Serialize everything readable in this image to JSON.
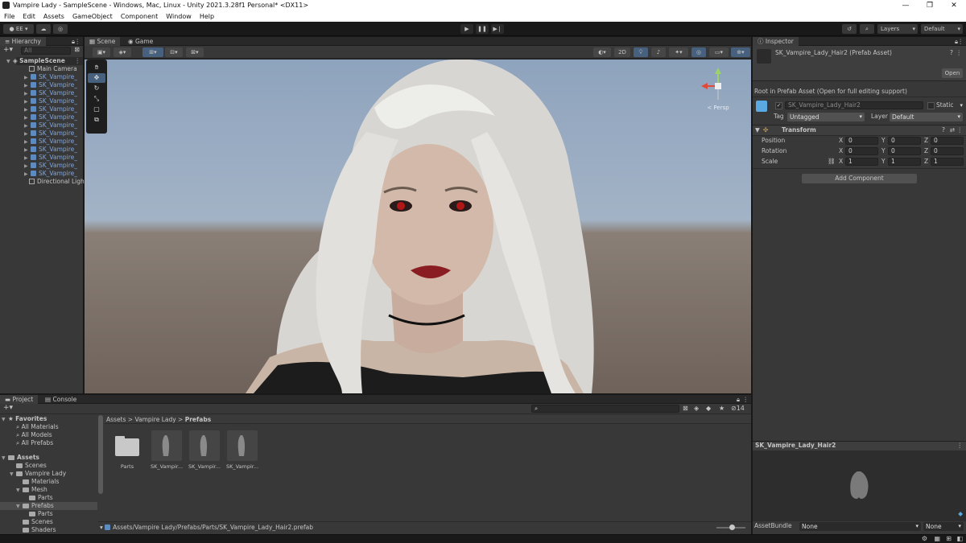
{
  "window": {
    "title": "Vampire Lady - SampleScene - Windows, Mac, Linux - Unity 2021.3.28f1 Personal* <DX11>"
  },
  "menu": [
    "File",
    "Edit",
    "Assets",
    "GameObject",
    "Component",
    "Window",
    "Help"
  ],
  "toolbar": {
    "account_label": "EE",
    "layers_label": "Layers",
    "layout_label": "Default"
  },
  "hierarchy": {
    "tab": "Hierarchy",
    "search_placeholder": "All",
    "scene": "SampleScene",
    "items": [
      "Main Camera",
      "SK_Vampire_",
      "SK_Vampire_",
      "SK_Vampire_",
      "SK_Vampire_",
      "SK_Vampire_",
      "SK_Vampire_",
      "SK_Vampire_",
      "SK_Vampire_",
      "SK_Vampire_",
      "SK_Vampire_",
      "SK_Vampire_",
      "SK_Vampire_",
      "SK_Vampire_",
      "Directional Ligh"
    ]
  },
  "scene": {
    "tabs": [
      "Scene",
      "Game"
    ],
    "mode_2d": "2D",
    "gizmo_label": "< Persp"
  },
  "inspector": {
    "tab": "Inspector",
    "asset_name": "SK_Vampire_Lady_Hair2 (Prefab Asset)",
    "open_label": "Open",
    "root_note": "Root in Prefab Asset (Open for full editing support)",
    "object_name": "SK_Vampire_Lady_Hair2",
    "static_label": "Static",
    "tag_label": "Tag",
    "tag_value": "Untagged",
    "layer_label": "Layer",
    "layer_value": "Default",
    "transform": {
      "title": "Transform",
      "rows": [
        {
          "label": "Position",
          "x": "0",
          "y": "0",
          "z": "0"
        },
        {
          "label": "Rotation",
          "x": "0",
          "y": "0",
          "z": "0"
        },
        {
          "label": "Scale",
          "x": "1",
          "y": "1",
          "z": "1"
        }
      ],
      "axis_x": "X",
      "axis_y": "Y",
      "axis_z": "Z"
    },
    "add_component": "Add Component",
    "preview_title": "SK_Vampire_Lady_Hair2",
    "assetbundle_label": "AssetBundle",
    "assetbundle_value": "None",
    "variant_value": "None"
  },
  "project": {
    "tabs": [
      "Project",
      "Console"
    ],
    "favorites_label": "Favorites",
    "favorites": [
      "All Materials",
      "All Models",
      "All Prefabs"
    ],
    "assets_label": "Assets",
    "tree": [
      {
        "label": "Scenes",
        "indent": 1
      },
      {
        "label": "Vampire Lady",
        "indent": 1
      },
      {
        "label": "Materials",
        "indent": 2
      },
      {
        "label": "Mesh",
        "indent": 2
      },
      {
        "label": "Parts",
        "indent": 3
      },
      {
        "label": "Prefabs",
        "indent": 2
      },
      {
        "label": "Parts",
        "indent": 3
      },
      {
        "label": "Scenes",
        "indent": 2
      },
      {
        "label": "Shaders",
        "indent": 2
      }
    ],
    "breadcrumb": [
      "Assets",
      "Vampire Lady",
      "Prefabs"
    ],
    "hidden_count": "14",
    "items": [
      "Parts",
      "SK_Vampir...",
      "SK_Vampir...",
      "SK_Vampir..."
    ],
    "status_path": "Assets/Vampire Lady/Prefabs/Parts/SK_Vampire_Lady_Hair2.prefab"
  },
  "colors": {
    "accent": "#4d78cc",
    "panel": "#383838",
    "dark": "#191919",
    "selection": "#2c5d87"
  }
}
